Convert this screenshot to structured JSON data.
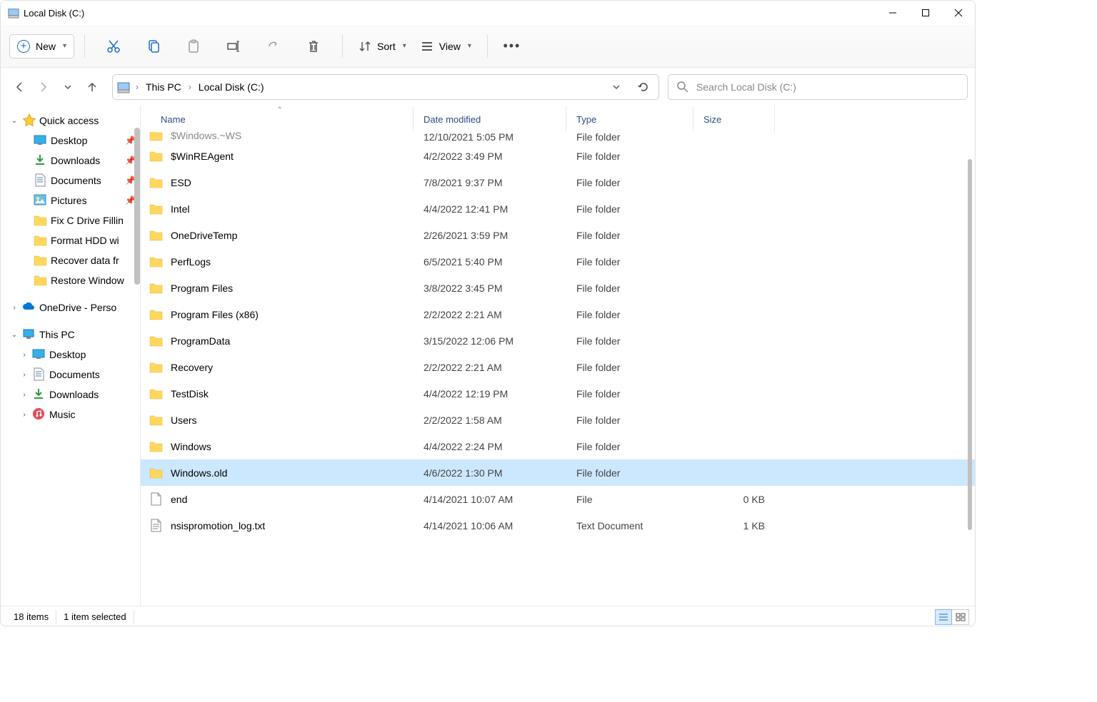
{
  "window": {
    "title": "Local Disk (C:)"
  },
  "toolbar": {
    "new_label": "New",
    "sort_label": "Sort",
    "view_label": "View"
  },
  "breadcrumb": {
    "items": [
      "This PC",
      "Local Disk (C:)"
    ]
  },
  "search": {
    "placeholder": "Search Local Disk (C:)"
  },
  "sidebar": {
    "quick_access": "Quick access",
    "quick_items": [
      {
        "label": "Desktop",
        "pinned": true
      },
      {
        "label": "Downloads",
        "pinned": true
      },
      {
        "label": "Documents",
        "pinned": true
      },
      {
        "label": "Pictures",
        "pinned": true
      },
      {
        "label": "Fix C Drive Fillin",
        "pinned": false
      },
      {
        "label": "Format HDD wi",
        "pinned": false
      },
      {
        "label": "Recover data fr",
        "pinned": false
      },
      {
        "label": "Restore Window",
        "pinned": false
      }
    ],
    "onedrive": "OneDrive - Perso",
    "this_pc": "This PC",
    "pc_items": [
      {
        "label": "Desktop"
      },
      {
        "label": "Documents"
      },
      {
        "label": "Downloads"
      },
      {
        "label": "Music"
      }
    ]
  },
  "columns": {
    "name": "Name",
    "date": "Date modified",
    "type": "Type",
    "size": "Size"
  },
  "files": [
    {
      "name": "$Windows.~WS",
      "date": "12/10/2021 5:05 PM",
      "type": "File folder",
      "size": "",
      "icon": "folder",
      "partial": true
    },
    {
      "name": "$WinREAgent",
      "date": "4/2/2022 3:49 PM",
      "type": "File folder",
      "size": "",
      "icon": "folder"
    },
    {
      "name": "ESD",
      "date": "7/8/2021 9:37 PM",
      "type": "File folder",
      "size": "",
      "icon": "folder"
    },
    {
      "name": "Intel",
      "date": "4/4/2022 12:41 PM",
      "type": "File folder",
      "size": "",
      "icon": "folder"
    },
    {
      "name": "OneDriveTemp",
      "date": "2/26/2021 3:59 PM",
      "type": "File folder",
      "size": "",
      "icon": "folder"
    },
    {
      "name": "PerfLogs",
      "date": "6/5/2021 5:40 PM",
      "type": "File folder",
      "size": "",
      "icon": "folder"
    },
    {
      "name": "Program Files",
      "date": "3/8/2022 3:45 PM",
      "type": "File folder",
      "size": "",
      "icon": "folder"
    },
    {
      "name": "Program Files (x86)",
      "date": "2/2/2022 2:21 AM",
      "type": "File folder",
      "size": "",
      "icon": "folder"
    },
    {
      "name": "ProgramData",
      "date": "3/15/2022 12:06 PM",
      "type": "File folder",
      "size": "",
      "icon": "folder"
    },
    {
      "name": "Recovery",
      "date": "2/2/2022 2:21 AM",
      "type": "File folder",
      "size": "",
      "icon": "folder"
    },
    {
      "name": "TestDisk",
      "date": "4/4/2022 12:19 PM",
      "type": "File folder",
      "size": "",
      "icon": "folder"
    },
    {
      "name": "Users",
      "date": "2/2/2022 1:58 AM",
      "type": "File folder",
      "size": "",
      "icon": "folder"
    },
    {
      "name": "Windows",
      "date": "4/4/2022 2:24 PM",
      "type": "File folder",
      "size": "",
      "icon": "folder"
    },
    {
      "name": "Windows.old",
      "date": "4/6/2022 1:30 PM",
      "type": "File folder",
      "size": "",
      "icon": "folder",
      "selected": true
    },
    {
      "name": "end",
      "date": "4/14/2021 10:07 AM",
      "type": "File",
      "size": "0 KB",
      "icon": "file"
    },
    {
      "name": "nsispromotion_log.txt",
      "date": "4/14/2021 10:06 AM",
      "type": "Text Document",
      "size": "1 KB",
      "icon": "textfile"
    }
  ],
  "status": {
    "count": "18 items",
    "selection": "1 item selected"
  }
}
